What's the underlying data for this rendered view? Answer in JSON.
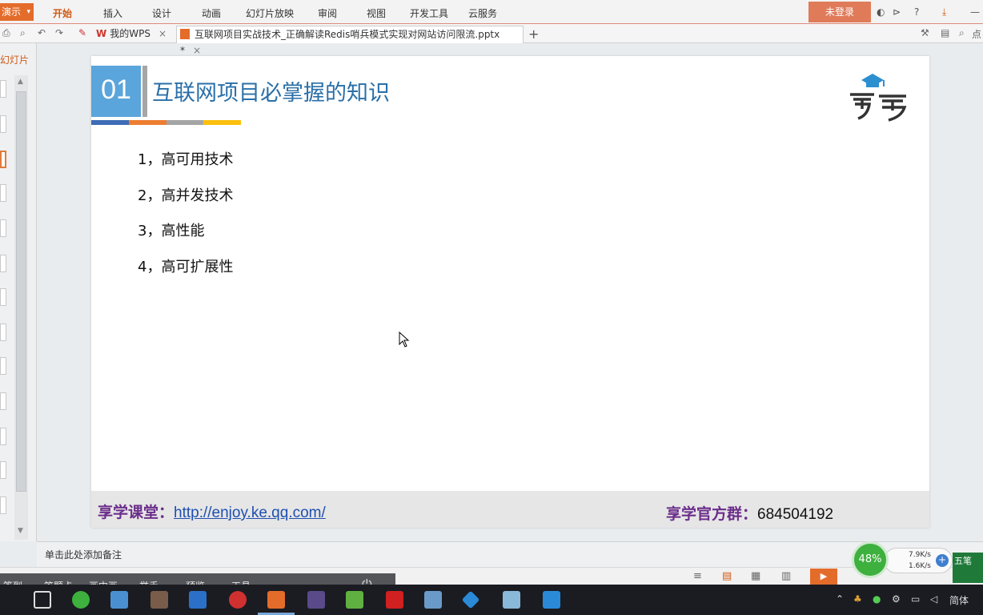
{
  "menubar": {
    "app_label": "演示",
    "items": [
      "开始",
      "插入",
      "设计",
      "动画",
      "幻灯片放映",
      "审阅",
      "视图",
      "开发工具",
      "云服务"
    ],
    "login_label": "未登录"
  },
  "tabs": {
    "wps_label": "我的WPS",
    "file_label": "互联网项目实战技术_正确解读Redis哨兵模式实现对网站访问限流.pptx *"
  },
  "left_panel": {
    "label": "幻灯片"
  },
  "slide": {
    "number": "01",
    "title": "互联网项目必掌握的知识",
    "bullets": [
      "1，高可用技术",
      "2，高并发技术",
      "3，高性能",
      "4，高可扩展性"
    ],
    "stripe_colors": [
      "#3e6cb5",
      "#ec7d31",
      "#a5a5a5",
      "#fbc00d"
    ],
    "footer": {
      "left_label": "享学课堂：",
      "link": "http://enjoy.ke.qq.com/",
      "right_label": "享学官方群：",
      "group_number": "684504192"
    }
  },
  "notes": {
    "placeholder": "单击此处添加备注"
  },
  "overlay_toolbar": {
    "items": [
      "签到",
      "答题卡",
      "画中画",
      "举手",
      "预览",
      "工具"
    ]
  },
  "net_widget": {
    "percent": "48%",
    "upload": "7.9K/s",
    "download": "1.6K/s"
  },
  "ime": {
    "label": "五笔"
  },
  "tray": {
    "lang": "简体"
  },
  "colors": {
    "accent": "#e46c2b",
    "title": "#2a6fa8",
    "footer_purple": "#6b2e8a"
  }
}
